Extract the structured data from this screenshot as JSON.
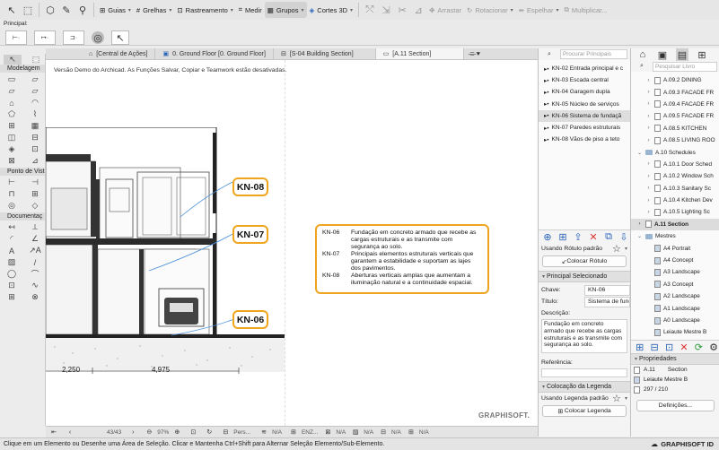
{
  "toolbar": {
    "guias": "Guias",
    "grelhas": "Grelhas",
    "rastreamento": "Rastreamento",
    "medir": "Medir",
    "grupos": "Grupos",
    "cortes3d": "Cortes 3D",
    "arrastar": "Arrastar",
    "rotacionar": "Rotacionar",
    "espelhar": "Espelhar",
    "multiplicar": "Multiplicar..."
  },
  "info_row": {
    "principal": "Principal:"
  },
  "toolbox": {
    "modelagem": "Modelagem",
    "ponto_vista": "Ponto de Vist",
    "documentacao": "Documentaç"
  },
  "tabs": [
    {
      "label": "[Central de Ações]"
    },
    {
      "label": "0. Ground Floor [0. Ground Floor]"
    },
    {
      "label": "[S-04 Building Section]"
    },
    {
      "label": "[A.11 Section]"
    }
  ],
  "canvas": {
    "demo_notice": "Versão Demo do Archicad. As Funções Salvar, Copiar e Teamwork estão desativadas.",
    "bubbles": [
      "KN-08",
      "KN-07",
      "KN-06"
    ],
    "dims": [
      "2,250",
      "4,975"
    ],
    "watermark": "GRAPHISOFT.",
    "legend": [
      {
        "code": "KN-06",
        "text": "Fundação em concreto armado que recebe as cargas estruturais e as transmite com segurança ao solo."
      },
      {
        "code": "KN-07",
        "text": "Principais elementos estruturais verticais que garantem a estabilidade e suportam as lajes dos pavimentos."
      },
      {
        "code": "KN-08",
        "text": "Aberturas verticais amplas que aumentam a iluminação natural e a continuidade espacial."
      }
    ]
  },
  "navbar": {
    "page_count": "43/43",
    "zoom": "97%",
    "pers": "Pers...",
    "enz": "ENZ...",
    "na": "N/A"
  },
  "statusbar": {
    "hint": "Clique em um Elemento ou Desenhe uma Área de Seleção. Clicar e Mantenha Ctrl+Shift para Alternar Seleção Elemento/Sub-Elemento.",
    "brand": "GRAPHISOFT ID"
  },
  "midpanel": {
    "search_placeholder": "Procurar Principais",
    "items": [
      "KN-02 Entrada principal e c",
      "KN-03 Escada central",
      "KN-04 Garagem dupla",
      "KN-05 Núcleo de serviços",
      "KN-06 Sistema de fundaçã",
      "KN-07 Paredes estruturais",
      "KN-08 Vãos de piso a teto"
    ],
    "selected_index": 4,
    "usando_rotulo": "Usando Rótulo padrão",
    "colocar_rotulo": "Colocar Rótulo",
    "principal_selecionado": "Principal Selecionado",
    "chave_label": "Chave:",
    "chave_value": "KN-06",
    "titulo_label": "Título:",
    "titulo_value": "Sistema de fund",
    "descricao_label": "Descrição:",
    "descricao_value": "Fundação em concreto armado que recebe as cargas estruturais e as transmite com segurança ao solo.",
    "referencia_label": "Referência:",
    "colocacao_legenda": "Colocação da Legenda",
    "usando_legenda": "Usando Legenda padrão",
    "colocar_legenda": "Colocar Legenda"
  },
  "rightpanel": {
    "search_placeholder": "Pesquisar Livro",
    "items": [
      {
        "label": "A.09.2 DINING",
        "indent": 1,
        "kind": "page"
      },
      {
        "label": "A.09.3 FACADE FR",
        "indent": 1,
        "kind": "page"
      },
      {
        "label": "A.09.4 FACADE FR",
        "indent": 1,
        "kind": "page"
      },
      {
        "label": "A.09.5 FACADE FR",
        "indent": 1,
        "kind": "page"
      },
      {
        "label": "A.08.5 KITCHEN",
        "indent": 1,
        "kind": "page"
      },
      {
        "label": "A.08.5 LIVING ROO",
        "indent": 1,
        "kind": "page"
      },
      {
        "label": "A.10 Schedules",
        "indent": 0,
        "kind": "folder"
      },
      {
        "label": "A.10.1 Door Sched",
        "indent": 1,
        "kind": "page"
      },
      {
        "label": "A.10.2 Window Sch",
        "indent": 1,
        "kind": "page"
      },
      {
        "label": "A.10.3 Sanitary Sc",
        "indent": 1,
        "kind": "page"
      },
      {
        "label": "A.10.4 Kitchen Dev",
        "indent": 1,
        "kind": "page"
      },
      {
        "label": "A.10.5 Lighting Sc",
        "indent": 1,
        "kind": "page"
      },
      {
        "label": "A.11 Section",
        "indent": 0,
        "kind": "page",
        "selected": true
      },
      {
        "label": "Mestres",
        "indent": 0,
        "kind": "folder"
      },
      {
        "label": "A4 Portrait",
        "indent": 1,
        "kind": "layout"
      },
      {
        "label": "A4 Concept",
        "indent": 1,
        "kind": "layout"
      },
      {
        "label": "A3 Landscape",
        "indent": 1,
        "kind": "layout"
      },
      {
        "label": "A3 Concept",
        "indent": 1,
        "kind": "layout"
      },
      {
        "label": "A2 Landscape",
        "indent": 1,
        "kind": "layout"
      },
      {
        "label": "A1 Landscape",
        "indent": 1,
        "kind": "layout"
      },
      {
        "label": "A0 Landscape",
        "indent": 1,
        "kind": "layout"
      },
      {
        "label": "Leiaute Mestre B",
        "indent": 1,
        "kind": "layout"
      }
    ],
    "propriedades": "Propriedades",
    "prop_num": "A.11",
    "prop_name": "Section",
    "prop_master": "Leiaute Mestre B",
    "prop_pages": "297 / 210",
    "definicoes": "Definições..."
  }
}
